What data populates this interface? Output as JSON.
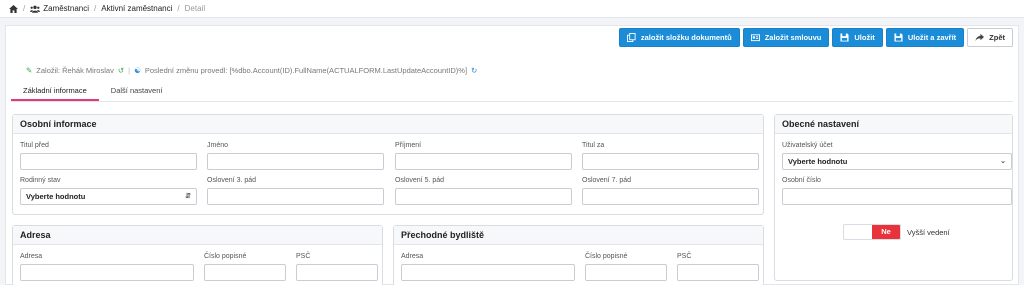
{
  "breadcrumb": {
    "items": [
      "Zaměstnanci",
      "Aktivní zaměstnanci",
      "Detail"
    ]
  },
  "toolbar": {
    "create_folder": "založit složku dokumentů",
    "create_contract": "Založit smlouvu",
    "save": "Uložit",
    "save_close": "Uložit a zavřít",
    "back": "Zpět"
  },
  "meta": {
    "created_by": "Založil: Řehák Miroslav",
    "last_change": "Poslední změnu provedl: [%dbo.Account(ID).FullName(ACTUALFORM.LastUpdateAccountID)%]"
  },
  "tabs": [
    "Základní informace",
    "Další nastavení"
  ],
  "personal": {
    "title": "Osobní informace",
    "fields": {
      "title_before": "Titul před",
      "first_name": "Jméno",
      "last_name": "Příjmení",
      "title_after": "Titul za",
      "marital_status": "Rodinný stav",
      "marital_status_value": "Vyberte hodnotu",
      "salutation3": "Oslovení 3. pád",
      "salutation5": "Oslovení 5. pád",
      "salutation7": "Oslovení 7. pád"
    }
  },
  "general": {
    "title": "Obecné nastavení",
    "user_account": "Uživatelský účet",
    "user_account_value": "Vyberte hodnotu",
    "personal_number": "Osobní číslo",
    "toggle_on": "Ne",
    "senior_management": "Vyšší vedení"
  },
  "address": {
    "title": "Adresa",
    "street": "Adresa",
    "house_number": "Číslo popisné",
    "zip": "PSČ"
  },
  "temp_address": {
    "title": "Přechodné bydliště",
    "street": "Adresa",
    "house_number": "Číslo popisné",
    "zip": "PSČ"
  },
  "colors": {
    "primary": "#1a8cd8",
    "danger": "#e8323c",
    "tab_accent": "#e0397e"
  }
}
